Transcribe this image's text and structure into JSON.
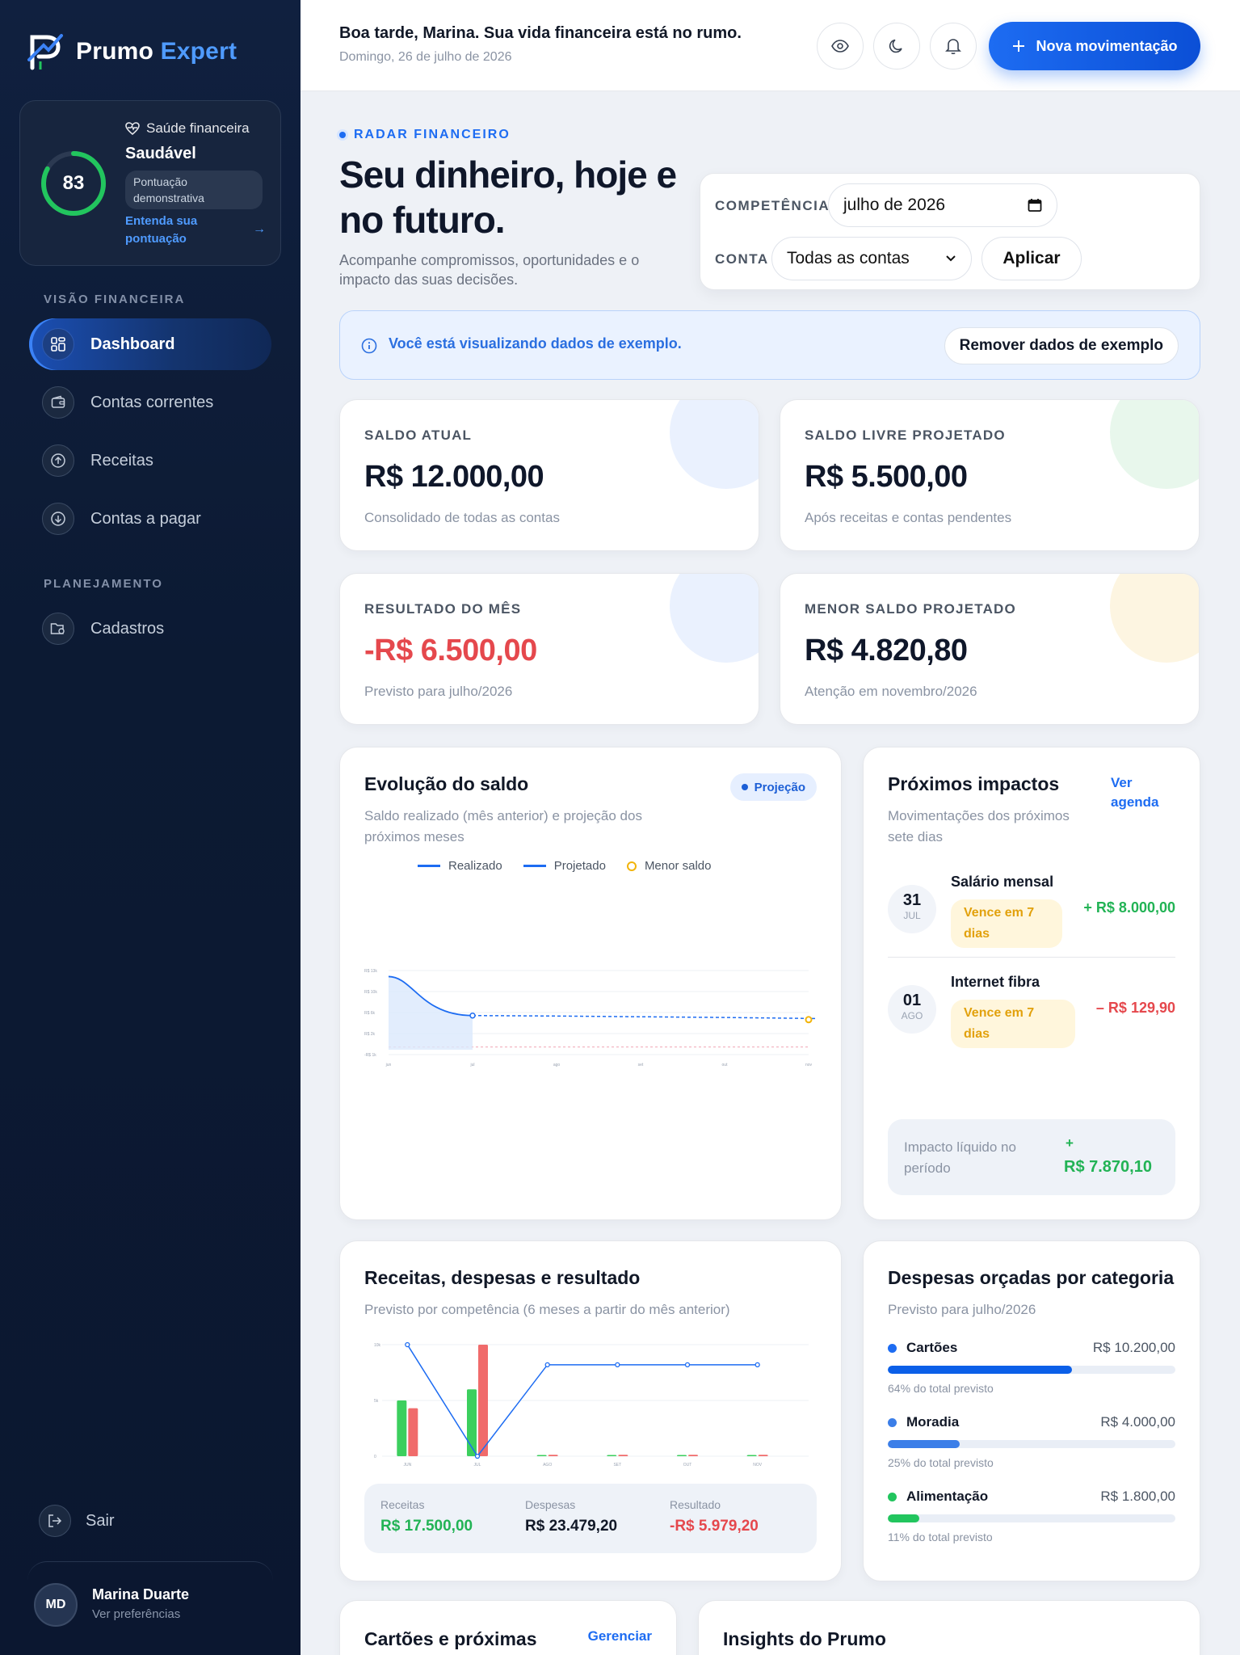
{
  "brand": {
    "name": "Prumo",
    "accent": "Expert"
  },
  "health": {
    "label": "Saúde financeira",
    "score": "83",
    "score_value": 0.83,
    "status": "Saudável",
    "pill": "Pontuação demonstrativa",
    "link": "Entenda sua pontuação",
    "color": "#22c55e"
  },
  "nav": {
    "section_vision": "VISÃO FINANCEIRA",
    "section_planning": "PLANEJAMENTO",
    "items": [
      {
        "label": "Dashboard",
        "icon": "grid-icon"
      },
      {
        "label": "Contas correntes",
        "icon": "wallet-icon"
      },
      {
        "label": "Receitas",
        "icon": "arrow-up-circle-icon"
      },
      {
        "label": "Contas a pagar",
        "icon": "arrow-down-circle-icon"
      },
      {
        "label": "Cadastros",
        "icon": "folder-gear-icon"
      }
    ],
    "logout": "Sair"
  },
  "user": {
    "initials": "MD",
    "name": "Marina Duarte",
    "sub": "Ver preferências"
  },
  "header": {
    "greeting": "Boa tarde, Marina. Sua vida financeira está no rumo.",
    "date": "Domingo, 26 de julho de 2026",
    "new_button": "Nova movimentação"
  },
  "hero": {
    "eyebrow": "RADAR FINANCEIRO",
    "title": "Seu dinheiro, hoje e no futuro.",
    "subtitle": "Acompanhe compromissos, oportunidades e o impacto das suas decisões."
  },
  "filters": {
    "competence_label": "COMPETÊNCIA",
    "competence_value": "julho de 2026",
    "account_label": "CONTA",
    "account_value": "Todas as contas",
    "apply": "Aplicar"
  },
  "notice": {
    "text": "Você está visualizando dados de exemplo.",
    "button": "Remover dados de exemplo"
  },
  "kpis": [
    {
      "label": "SALDO ATUAL",
      "value": "R$ 12.000,00",
      "sub": "Consolidado de todas as contas",
      "blob": "#eaf1fe",
      "negative": false
    },
    {
      "label": "SALDO LIVRE PROJETADO",
      "value": "R$ 5.500,00",
      "sub": "Após receitas e contas pendentes",
      "blob": "#e8f7ec",
      "negative": false
    },
    {
      "label": "RESULTADO DO MÊS",
      "value": "-R$ 6.500,00",
      "sub": "Previsto para julho/2026",
      "blob": "#eaf1fe",
      "negative": true
    },
    {
      "label": "MENOR SALDO PROJETADO",
      "value": "R$ 4.820,80",
      "sub": "Atenção em novembro/2026",
      "blob": "#fdf5e1",
      "negative": false
    }
  ],
  "balance_chart": {
    "title": "Evolução do saldo",
    "subtitle": "Saldo realizado (mês anterior) e projeção dos próximos meses",
    "badge": "Projeção",
    "legend": [
      "Realizado",
      "Projetado",
      "Menor saldo"
    ]
  },
  "impacts": {
    "title": "Próximos impactos",
    "link": "Ver agenda",
    "subtitle": "Movimentações dos próximos sete dias",
    "items": [
      {
        "day": "31",
        "month": "JUL",
        "name": "Salário mensal",
        "tag": "Vence em 7 dias",
        "amount": "+ R$ 8.000,00",
        "color": "#22b355"
      },
      {
        "day": "01",
        "month": "AGO",
        "name": "Internet fibra",
        "tag": "Vence em 7 dias",
        "amount": "– R$ 129,90",
        "color": "#e5484d"
      }
    ],
    "net_label": "Impacto líquido no período",
    "net_sign": "+",
    "net_value": "R$ 7.870,10"
  },
  "rev_chart": {
    "title": "Receitas, despesas e resultado",
    "subtitle": "Previsto por competência (6 meses a partir do mês anterior)",
    "summary": [
      {
        "label": "Receitas",
        "value": "R$ 17.500,00",
        "color": "#22b355"
      },
      {
        "label": "Despesas",
        "value": "R$ 23.479,20",
        "color": "#111827"
      },
      {
        "label": "Resultado",
        "value": "-R$ 5.979,20",
        "color": "#e5484d"
      }
    ]
  },
  "categories": {
    "title": "Despesas orçadas por categoria",
    "subtitle": "Previsto para julho/2026",
    "items": [
      {
        "name": "Cartões",
        "value": "R$ 10.200,00",
        "pct_text": "64% do total previsto",
        "pct": 0.64,
        "color": "#0b5fe8",
        "dot": "#1d6cf2"
      },
      {
        "name": "Moradia",
        "value": "R$ 4.000,00",
        "pct_text": "25% do total previsto",
        "pct": 0.25,
        "color": "#3b7ee8",
        "dot": "#3b7ee8"
      },
      {
        "name": "Alimentação",
        "value": "R$ 1.800,00",
        "pct_text": "11% do total previsto",
        "pct": 0.11,
        "color": "#22c55e",
        "dot": "#22c55e"
      }
    ]
  },
  "bottom_cards": {
    "cards_title": "Cartões e próximas",
    "cards_link": "Gerenciar",
    "insights_title": "Insights do Prumo"
  },
  "chart_data": [
    {
      "type": "line",
      "y_ticks": [
        "R$ 13k",
        "R$ 10k",
        "R$ 6k",
        "R$ 2k",
        "-R$ 1k"
      ],
      "categories": [
        "jun",
        "jul",
        "ago",
        "set",
        "out",
        "nov"
      ],
      "realized": [
        12000,
        5500
      ],
      "projected": [
        5500,
        5420,
        5300,
        5180,
        5020,
        4820.8
      ],
      "min_balance": 4820.8,
      "ylim": [
        -1000,
        13000
      ]
    },
    {
      "type": "bar",
      "y_ticks": [
        "10k",
        "5k",
        "0"
      ],
      "categories": [
        "JUN",
        "JUL",
        "AGO",
        "SET",
        "OUT",
        "NOV"
      ],
      "series": [
        {
          "values": [
            5000,
            6000,
            0,
            0,
            0,
            0
          ],
          "color": "#3ccf5e"
        },
        {
          "values": [
            4300,
            10000,
            130,
            130,
            130,
            130
          ],
          "color": "#f06b6b"
        },
        {
          "values": [
            10000,
            0,
            8200,
            8200,
            8200,
            8200
          ],
          "color": "#1d6cf2"
        }
      ],
      "ylim": [
        0,
        10000
      ]
    }
  ]
}
